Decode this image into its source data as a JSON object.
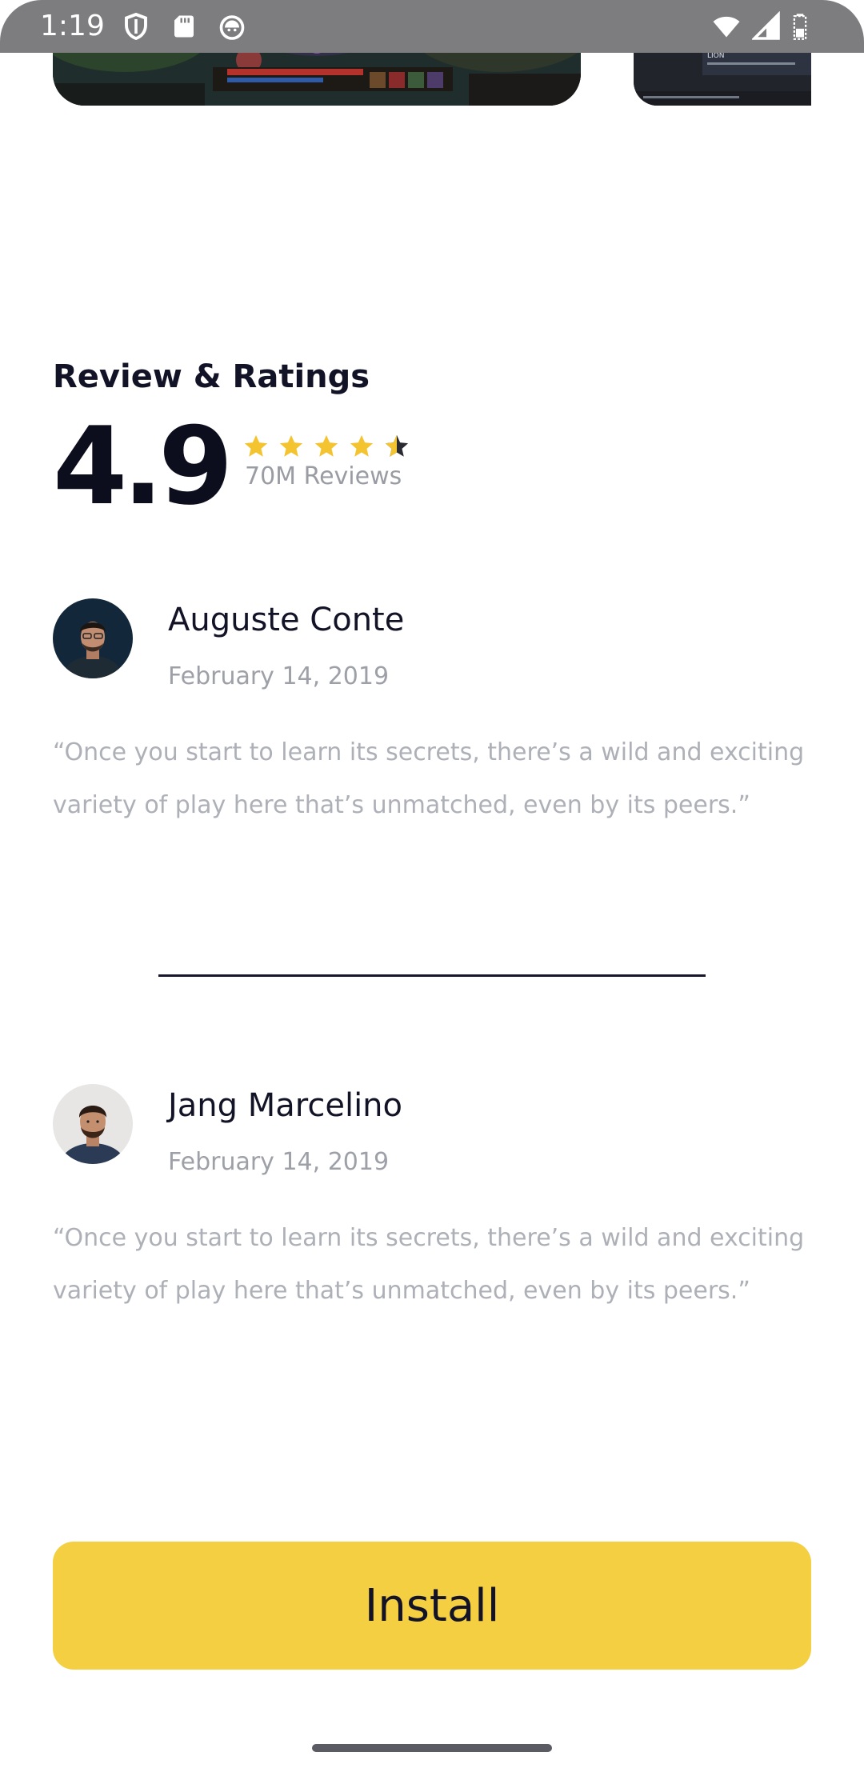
{
  "status_bar": {
    "time": "1:19",
    "left_icons": [
      "shield-icon",
      "sd-card-icon",
      "cat-face-icon"
    ],
    "right_icons": [
      "wifi-icon",
      "cellular-signal-icon",
      "battery-icon"
    ]
  },
  "screenshots": {
    "items": [
      "game-screenshot",
      "game-screenshot"
    ],
    "side_caption": "LION"
  },
  "reviews_section": {
    "title": "Review & Ratings",
    "score": "4.9",
    "stars": 4.5,
    "review_count": "70M Reviews",
    "star_color": "#f4c430"
  },
  "reviews": [
    {
      "name": "Auguste Conte",
      "date": "February 14, 2019",
      "text": "“Once you start to learn its secrets, there’s a wild and exciting variety of play here that’s unmatched, even by its peers.”"
    },
    {
      "name": "Jang Marcelino",
      "date": "February 14, 2019",
      "text": "“Once you start to learn its secrets, there’s a wild and exciting variety of play here that’s unmatched, even by its peers.”"
    }
  ],
  "install_button": {
    "label": "Install",
    "color": "#f4cf41"
  }
}
